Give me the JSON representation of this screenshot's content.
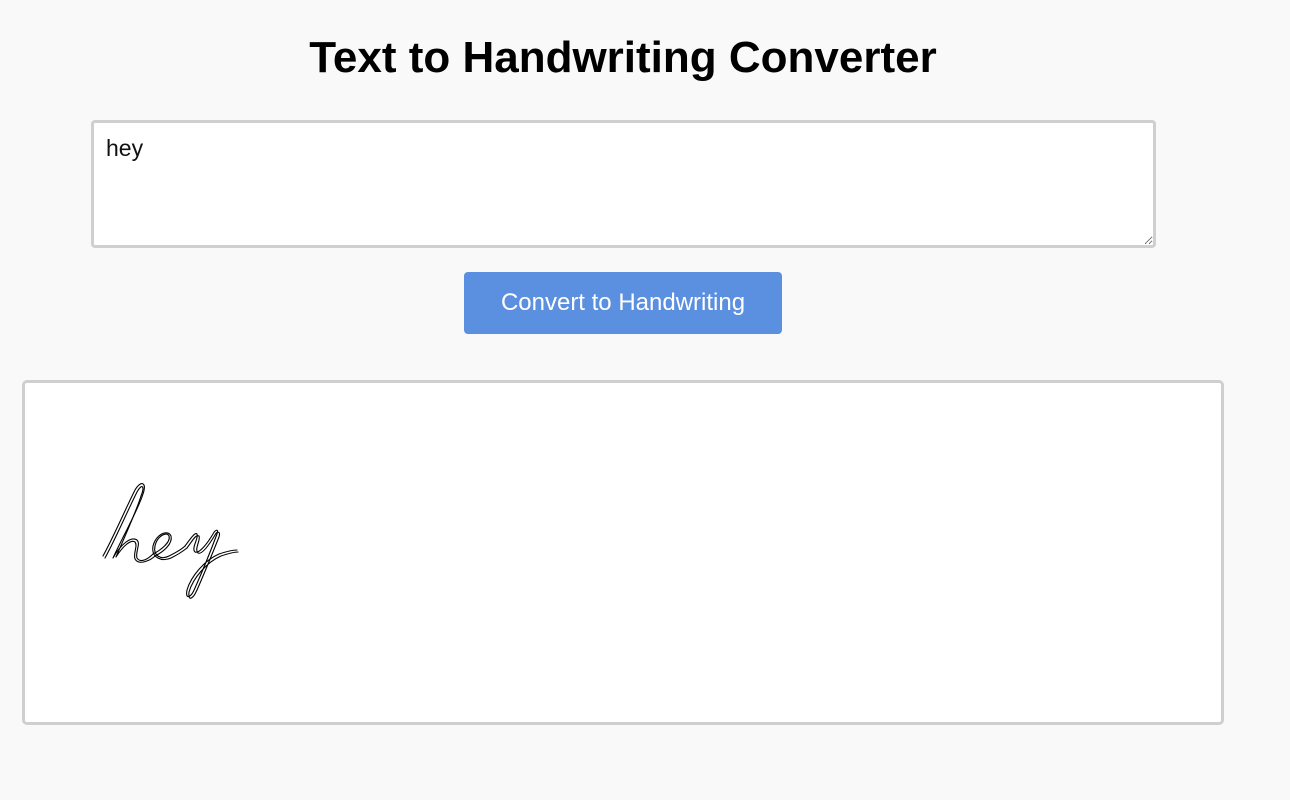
{
  "page": {
    "title": "Text to Handwriting Converter"
  },
  "input": {
    "value": "hey"
  },
  "actions": {
    "convert_label": "Convert to Handwriting"
  },
  "output": {
    "rendered_text": "hey"
  },
  "colors": {
    "background": "#f9f9f9",
    "button_bg": "#5b8fdf",
    "button_text": "#ffffff",
    "border": "#cfcfcf",
    "ink": "#000000"
  }
}
